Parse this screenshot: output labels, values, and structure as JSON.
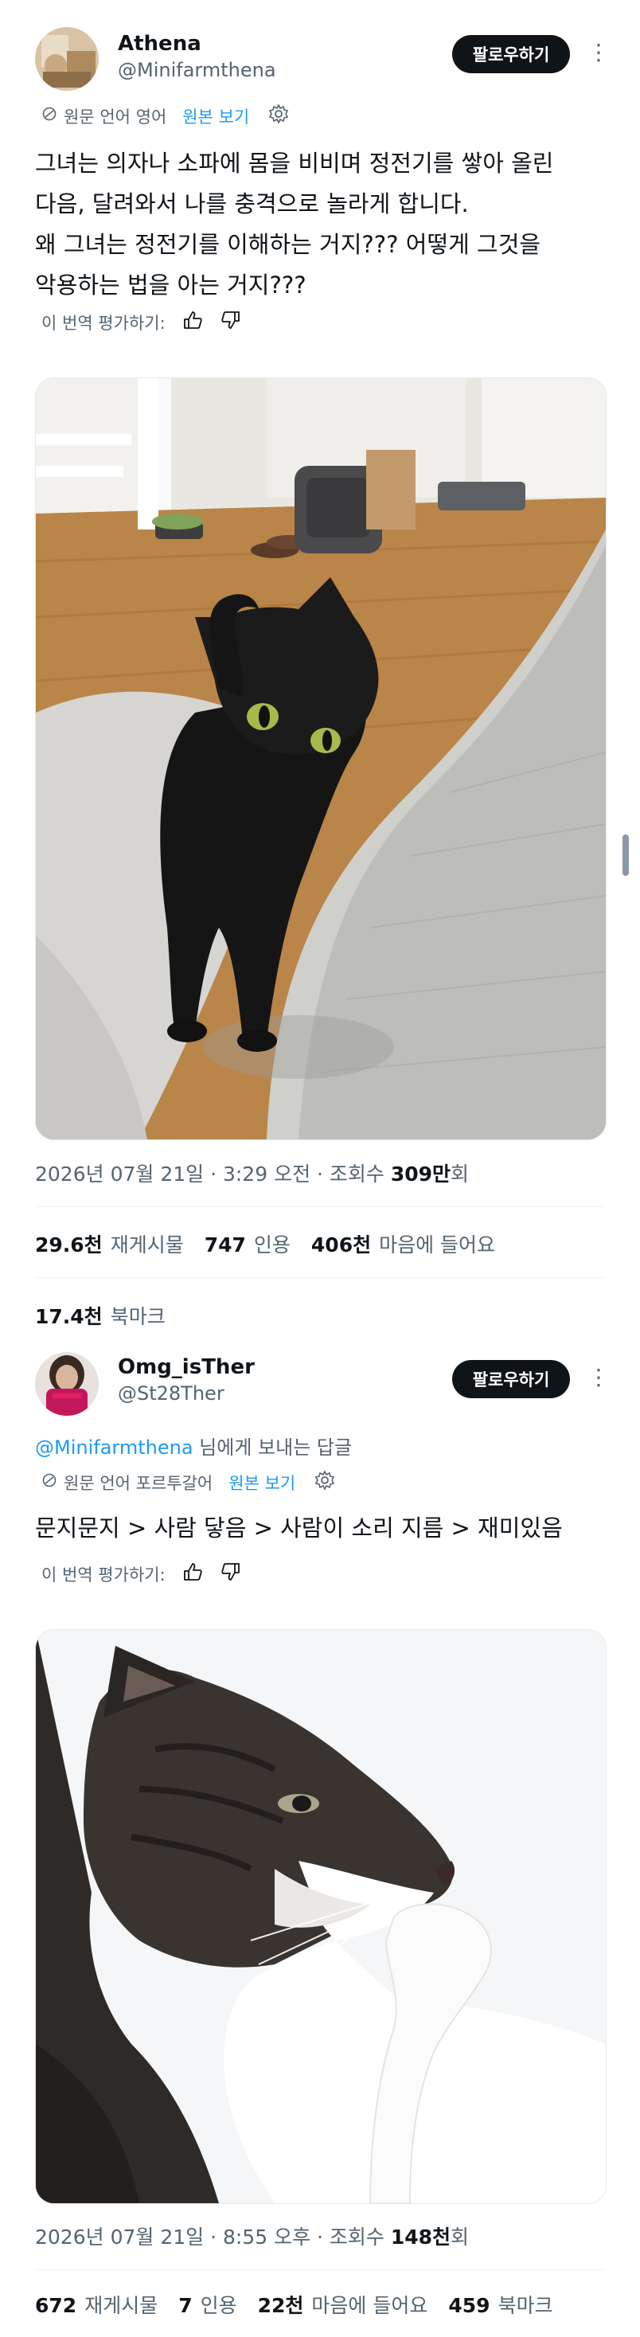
{
  "tweet1": {
    "name": "Athena",
    "handle": "@Minifarmthena",
    "follow_label": "팔로우하기",
    "more_label": "⋮",
    "source_lang": "원문 언어 영어",
    "show_original": "원본 보기",
    "text": "그녀는 의자나 소파에 몸을 비비며 정전기를 쌓아 올린\n다음, 달려와서 나를 충격으로 놀라게 합니다.\n왜 그녀는 정전기를 이해하는 거지??? 어떻게 그것을\n악용하는 법을 아는 거지???",
    "rate_label": "이 번역 평가하기:",
    "timestamp_prefix": "2026년 07월 21일 · 3:29 오전 · 조회수 ",
    "views": "309만",
    "views_suffix": "회",
    "retweets_num": "29.6천",
    "retweets_label": "재게시물",
    "quotes_num": "747",
    "quotes_label": "인용",
    "likes_num": "406천",
    "likes_label": "마음에 들어요",
    "bookmarks_num": "17.4천",
    "bookmarks_label": "북마크"
  },
  "tweet2": {
    "name": "Omg_isTher",
    "handle": "@St28Ther",
    "follow_label": "팔로우하기",
    "more_label": "⋮",
    "reply_handle": "@Minifarmthena",
    "reply_suffix": " 님에게 보내는 답글",
    "source_lang": "원문 언어 포르투갈어",
    "show_original": "원본 보기",
    "text": "문지문지 > 사람 닿음 > 사람이 소리 지름 > 재미있음",
    "rate_label": "이 번역 평가하기:",
    "timestamp_prefix": "2026년 07월 21일 · 8:55 오후 · 조회수 ",
    "views": "148천",
    "views_suffix": "회",
    "retweets_num": "672",
    "retweets_label": "재게시물",
    "quotes_num": "7",
    "quotes_label": "인용",
    "likes_num": "22천",
    "likes_label": "마음에 들어요",
    "bookmarks_num": "459",
    "bookmarks_label": "북마크"
  },
  "colors": {
    "text": "#0f1419",
    "secondary": "#536471",
    "link": "#1d9bf0",
    "follow_bg": "#0f1419"
  }
}
